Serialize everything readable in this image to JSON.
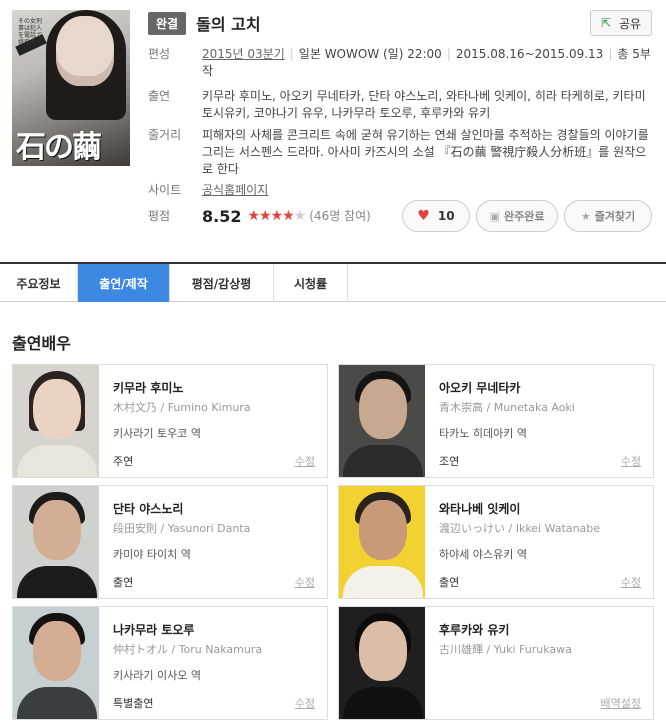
{
  "poster": {
    "title": "石の繭",
    "side_text": "その女刑事は犯人を電話で挑発する"
  },
  "drama": {
    "status_badge": "완결",
    "title": "돌의 고치",
    "share_label": "공유",
    "schedule_label": "편성",
    "schedule_quarter": "2015년 03분기",
    "schedule_channel": "일본 WOWOW (일) 22:00",
    "schedule_period": "2015.08.16~2015.09.13",
    "schedule_episodes": "총 5부작",
    "cast_label": "출연",
    "cast_text": "키무라 후미노, 아오키 무네타카, 단타 야스노리, 와타나베 잇케이, 히라 타케히로, 키타미 토시유키, 코야나기 유우, 나카무라 토오루, 후루카와 유키",
    "plot_label": "줄거리",
    "plot_text": "피해자의 사체를 콘크리트 속에 굳혀 유기하는 연쇄 살인마를 추적하는 경찰들의 이야기를 그리는 서스펜스 드라마. 아사미 카즈시의 소설 『石の繭 警視庁殺人分析班』를 원작으로 한다",
    "site_label": "사이트",
    "site_link": "공식홈페이지",
    "rating_label": "평점",
    "rating_score": "8.52",
    "rating_count": "(46명 참여)",
    "rating_stars_value": 4.3
  },
  "actions": {
    "like_count": "10",
    "complete_label": "완주완료",
    "favorite_label": "즐겨찾기"
  },
  "tabs": [
    {
      "label": "주요정보"
    },
    {
      "label": "출연/제작"
    },
    {
      "label": "평점/감상평"
    },
    {
      "label": "시청률"
    }
  ],
  "section_title": "출연배우",
  "cast": [
    {
      "name": "키무라 후미노",
      "original": "木村文乃 / Fumino Kimura",
      "role": "키사라기 토우코 역",
      "type": "주연",
      "edit": "수정"
    },
    {
      "name": "아오키 무네타카",
      "original": "青木崇高 / Munetaka Aoki",
      "role": "타카노 히데아키 역",
      "type": "조연",
      "edit": "수정"
    },
    {
      "name": "단타 야스노리",
      "original": "段田安則 / Yasunori Danta",
      "role": "카미야 타이치 역",
      "type": "출연",
      "edit": "수정"
    },
    {
      "name": "와타나베 잇케이",
      "original": "渡辺いっけい / Ikkei Watanabe",
      "role": "하야세 야스유키 역",
      "type": "출연",
      "edit": "수정"
    },
    {
      "name": "나카무라 토오루",
      "original": "仲村トオル / Toru Nakamura",
      "role": "키사라기 이사오 역",
      "type": "특별출연",
      "edit": "수정"
    },
    {
      "name": "후루카와 유키",
      "original": "古川雄輝 / Yuki Furukawa",
      "role": "",
      "type": "",
      "edit": "배역설정"
    }
  ]
}
